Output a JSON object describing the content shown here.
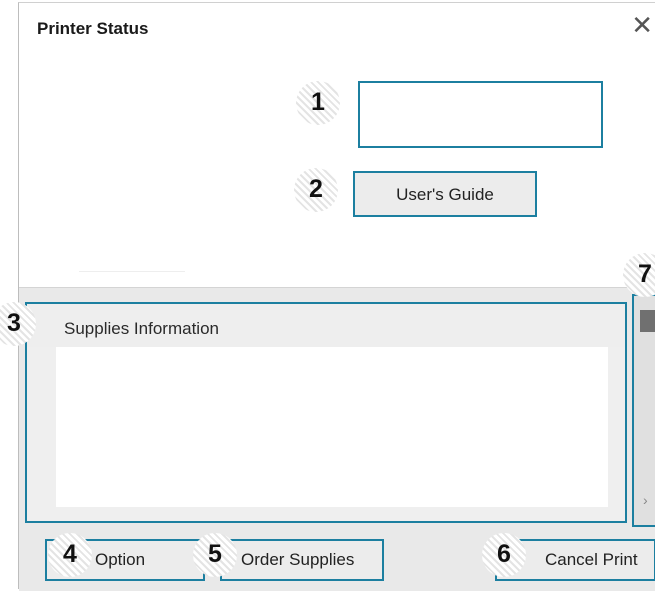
{
  "window": {
    "title": "Printer Status",
    "close_glyph": "✕"
  },
  "status_display": {
    "value": ""
  },
  "buttons": {
    "users_guide": "User's Guide",
    "option": "Option",
    "order_supplies": "Order Supplies",
    "cancel_print": "Cancel Print"
  },
  "supplies": {
    "header": "Supplies Information"
  },
  "side_panel": {
    "chevron": "›"
  },
  "callouts": [
    "1",
    "2",
    "3",
    "4",
    "5",
    "6",
    "7"
  ],
  "colors": {
    "highlight_border": "#1c7fa0",
    "panel_bg": "#e9e9e9",
    "button_bg": "#ececec"
  }
}
